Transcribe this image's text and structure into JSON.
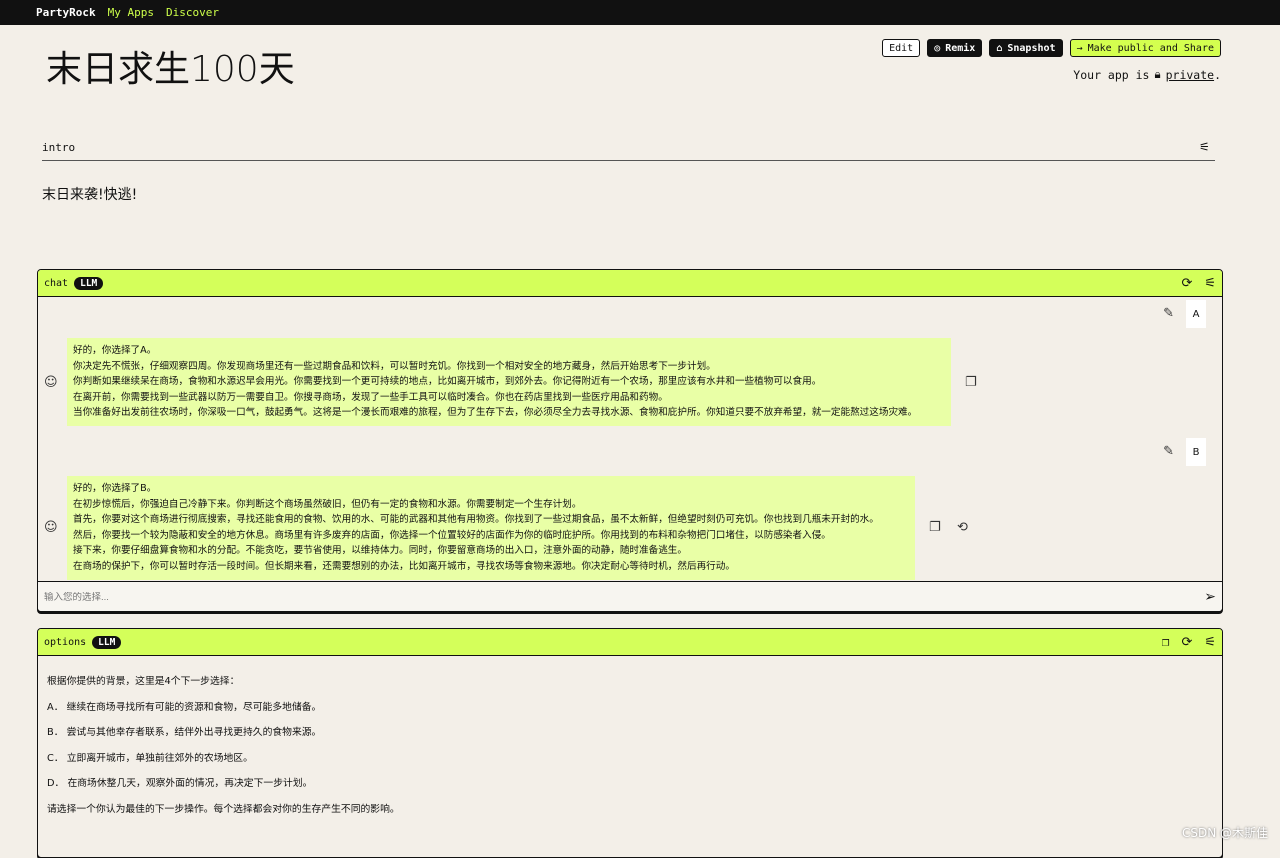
{
  "topbar": {
    "logo": "PartyRock",
    "nav": [
      "My Apps",
      "Discover"
    ]
  },
  "app": {
    "title": "末日求生100天"
  },
  "actions": {
    "edit": "Edit",
    "remix": "Remix",
    "snapshot": "Snapshot",
    "share": "Make public and Share"
  },
  "privacy": {
    "prefix": "Your app is",
    "link": "private",
    "suffix": "."
  },
  "intro": {
    "label": "intro",
    "text": "末日来袭!快逃!"
  },
  "chat": {
    "label": "chat",
    "badge": "LLM",
    "input_placeholder": "输入您的选择...",
    "messages": [
      {
        "label": "A",
        "lines": [
          "好的，你选择了A。",
          "你决定先不慌张，仔细观察四周。你发现商场里还有一些过期食品和饮料，可以暂时充饥。你找到一个相对安全的地方藏身，然后开始思考下一步计划。",
          "你判断如果继续呆在商场，食物和水源迟早会用光。你需要找到一个更可持续的地点，比如离开城市，到郊外去。你记得附近有一个农场，那里应该有水井和一些植物可以食用。",
          "在离开前，你需要找到一些武器以防万一需要自卫。你搜寻商场，发现了一些手工具可以临时凑合。你也在药店里找到一些医疗用品和药物。",
          "当你准备好出发前往农场时，你深吸一口气，鼓起勇气。这将是一个漫长而艰难的旅程，但为了生存下去，你必须尽全力去寻找水源、食物和庇护所。你知道只要不放弃希望，就一定能熬过这场灾难。"
        ]
      },
      {
        "label": "B",
        "lines": [
          "好的，你选择了B。",
          "在初步惊慌后，你强迫自己冷静下来。你判断这个商场虽然破旧，但仍有一定的食物和水源。你需要制定一个生存计划。",
          "首先，你要对这个商场进行彻底搜索，寻找还能食用的食物、饮用的水、可能的武器和其他有用物资。你找到了一些过期食品，虽不太新鲜，但绝望时刻仍可充饥。你也找到几瓶未开封的水。",
          "然后，你要找一个较为隐蔽和安全的地方休息。商场里有许多废弃的店面，你选择一个位置较好的店面作为你的临时庇护所。你用找到的布料和杂物把门口堵住，以防感染者入侵。",
          "接下来，你要仔细盘算食物和水的分配。不能贪吃，要节省使用，以维持体力。同时，你要留意商场的出入口，注意外面的动静，随时准备逃生。",
          "在商场的保护下，你可以暂时存活一段时间。但长期来看，还需要想别的办法，比如离开城市，寻找农场等食物来源地。你决定耐心等待时机，然后再行动。"
        ]
      }
    ]
  },
  "options": {
    "label": "options",
    "badge": "LLM",
    "lines": [
      "根据你提供的背景，这里是4个下一步选择：",
      "A． 继续在商场寻找所有可能的资源和食物，尽可能多地储备。",
      "B． 尝试与其他幸存者联系，结伴外出寻找更持久的食物来源。",
      "C． 立即离开城市，单独前往郊外的农场地区。",
      "D． 在商场休整几天，观察外面的情况，再决定下一步计划。",
      "请选择一个你认为最佳的下一步操作。每个选择都会对你的生存产生不同的影响。"
    ]
  },
  "watermark": "CSDN @木斯佳",
  "colors": {
    "accent": "#d4ff5a",
    "bubble": "#e9ffa6",
    "background": "#f3efe8",
    "topbar": "#111111"
  }
}
